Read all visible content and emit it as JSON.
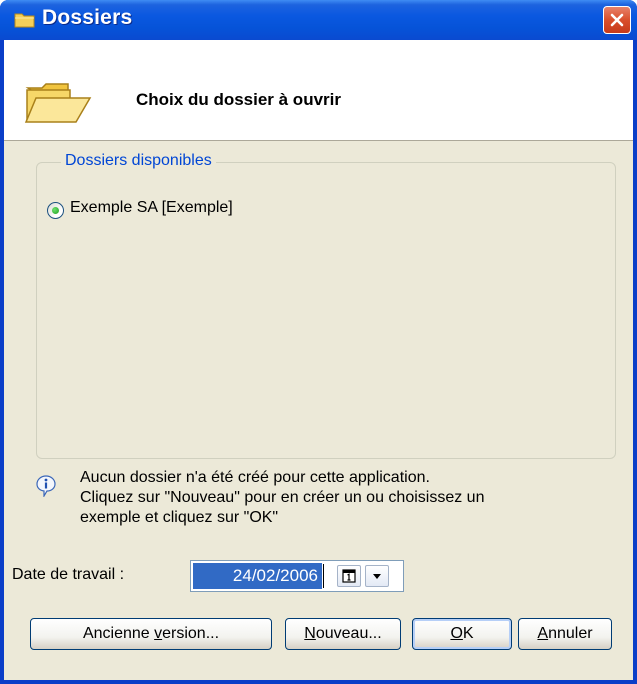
{
  "window": {
    "title": "Dossiers"
  },
  "header": {
    "title": "Choix du dossier à ouvrir"
  },
  "group": {
    "legend": "Dossiers disponibles",
    "items": [
      {
        "label": "Exemple SA [Exemple]",
        "selected": true
      }
    ]
  },
  "info": {
    "lines": [
      "Aucun dossier n'a été créé pour cette application.",
      "Cliquez sur \"Nouveau\" pour en créer un ou choisissez un",
      "exemple et cliquez sur \"OK\""
    ]
  },
  "date": {
    "label": "Date de travail :",
    "value": "24/02/2006"
  },
  "buttons": {
    "ancienne": {
      "before": "Ancienne ",
      "mnemonic": "v",
      "after": "ersion..."
    },
    "nouveau": {
      "before": "",
      "mnemonic": "N",
      "after": "ouveau..."
    },
    "ok": {
      "before": "",
      "mnemonic": "O",
      "after": "K"
    },
    "annuler": {
      "before": "",
      "mnemonic": "A",
      "after": "nnuler"
    }
  },
  "icons": {
    "title": "folder-icon",
    "header": "open-folder-icon",
    "info": "info-icon",
    "close": "close-icon",
    "calendar": "calendar-icon",
    "dropdown": "chevron-down-icon"
  },
  "colors": {
    "titlebar": "#0a58e0",
    "accent": "#316ac5",
    "legend": "#0046d5",
    "background": "#ece9d8"
  }
}
